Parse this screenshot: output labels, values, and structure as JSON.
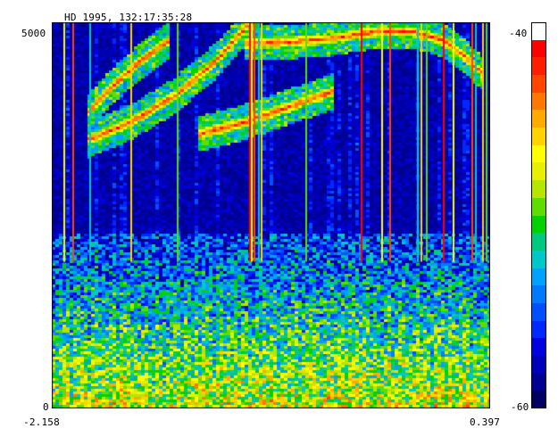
{
  "chart_data": {
    "type": "heatmap",
    "title": "HD 1995, 132:17:35:28",
    "x_range": [
      -2.158,
      0.397
    ],
    "y_range": [
      0,
      5000
    ],
    "x_tick_labels": [
      "-2.158",
      "0.397"
    ],
    "y_tick_labels": [
      "0",
      "5000"
    ],
    "colorbar": {
      "range": [
        -60,
        -40
      ],
      "tick_labels": [
        "-40",
        "-60"
      ],
      "colors": [
        "#000060",
        "#000090",
        "#0000b8",
        "#0000e0",
        "#0028ff",
        "#0050ff",
        "#0078ff",
        "#00a0ff",
        "#00c8c8",
        "#00c880",
        "#00d200",
        "#60dc00",
        "#b4e600",
        "#e6f000",
        "#ffff00",
        "#ffd200",
        "#ffaa00",
        "#ff7800",
        "#ff4600",
        "#ff1e00",
        "#ff0000",
        "#ffffff"
      ]
    },
    "features": [
      {
        "name": "upper arc",
        "x": [
          -1.96,
          -1.8,
          -1.64,
          -1.48
        ],
        "y": [
          3800,
          4180,
          4500,
          4760
        ]
      },
      {
        "name": "lower arc",
        "x": [
          -1.96,
          -1.7,
          -1.44,
          -1.2,
          -1.04,
          -0.95
        ],
        "y": [
          3460,
          3700,
          4050,
          4500,
          4900,
          5200
        ]
      },
      {
        "name": "plateau",
        "x": [
          -1.04,
          -0.78,
          -0.52,
          -0.26,
          -0.05,
          0.13,
          0.28,
          0.37
        ],
        "y": [
          4720,
          4740,
          4790,
          4880,
          4880,
          4760,
          4500,
          4300
        ]
      },
      {
        "name": "lower branch",
        "x": [
          -1.3,
          -1.04,
          -0.78,
          -0.52
        ],
        "y": [
          3550,
          3700,
          3900,
          4100
        ]
      }
    ],
    "vertical_lines_x": [
      -2.09,
      -2.04,
      -1.94,
      -1.7,
      -1.43,
      -1.01,
      -0.995,
      -0.98,
      -0.955,
      -0.94,
      -0.68,
      -0.36,
      -0.24,
      -0.19,
      -0.03,
      -0.01,
      0.02,
      0.12,
      0.18,
      0.29,
      0.31,
      0.35,
      0.37
    ]
  }
}
